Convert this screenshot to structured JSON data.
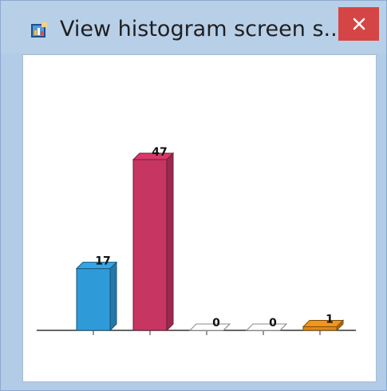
{
  "window": {
    "title": "View histogram screen s...",
    "close_glyph": "✕",
    "app_icon": "histogram-app-icon"
  },
  "colors": {
    "titlebar": "#b8cfe8",
    "close_button": "#d64545",
    "client_bg": "#ffffff"
  },
  "chart_data": {
    "type": "bar",
    "style": "3d",
    "values": [
      17,
      47,
      0,
      0,
      1
    ],
    "value_labels": [
      "17",
      "47",
      "0",
      "0",
      "1"
    ],
    "colors": [
      "#2f9ad8",
      "#c73563",
      "#ffffff",
      "#ffffff",
      "#e08a18"
    ],
    "ylim": [
      0,
      47
    ],
    "grid": false
  }
}
